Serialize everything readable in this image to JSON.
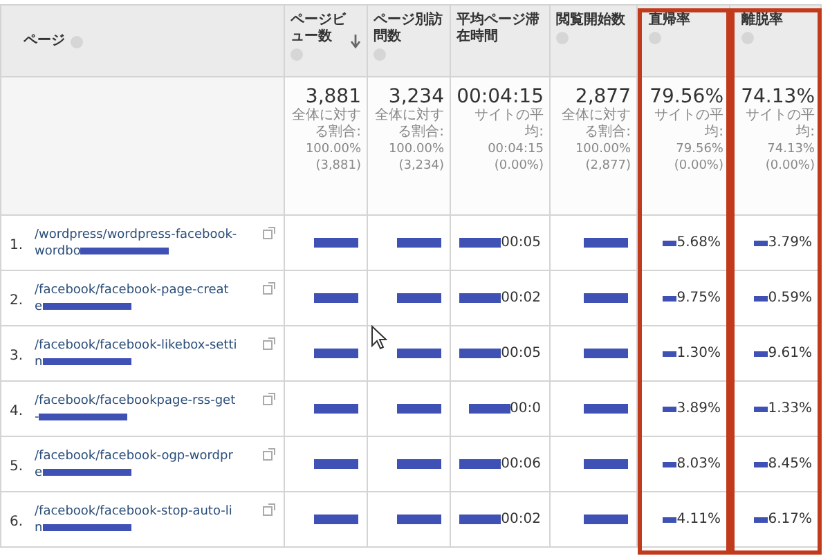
{
  "columns": [
    {
      "label": "ページ",
      "sorted": false,
      "help": true,
      "highlighted": false
    },
    {
      "label": "ページビュー数",
      "sorted": true,
      "help": true,
      "highlighted": false
    },
    {
      "label": "ページ別訪問数",
      "sorted": false,
      "help": true,
      "highlighted": false
    },
    {
      "label": "平均ページ滞在時間",
      "sorted": false,
      "help": false,
      "highlighted": false
    },
    {
      "label": "閲覧開始数",
      "sorted": false,
      "help": true,
      "highlighted": false
    },
    {
      "label": "直帰率",
      "sorted": false,
      "help": true,
      "highlighted": true
    },
    {
      "label": "離脱率",
      "sorted": false,
      "help": true,
      "highlighted": true
    }
  ],
  "summary": [
    {
      "value": "3,881",
      "note": "全体に対する割合:",
      "share": "100.00%",
      "total": "(3,881)"
    },
    {
      "value": "3,234",
      "note": "全体に対する割合:",
      "share": "100.00%",
      "total": "(3,234)"
    },
    {
      "value": "00:04:15",
      "note": "サイトの平均:",
      "share": "00:04:15",
      "total": "(0.00%)"
    },
    {
      "value": "2,877",
      "note": "全体に対する割合:",
      "share": "100.00%",
      "total": "(2,877)"
    },
    {
      "value": "79.56%",
      "note": "サイトの平均:",
      "share": "79.56%",
      "total": "(0.00%)"
    },
    {
      "value": "74.13%",
      "note": "サイトの平均:",
      "share": "74.13%",
      "total": "(0.00%)"
    }
  ],
  "rows": [
    {
      "rank": "1.",
      "page": [
        "/wordpress/wordpress-facebook-",
        "wordbo"
      ],
      "cells": [
        {
          "redacted": true
        },
        {
          "redacted": true
        },
        {
          "text": "00:05",
          "redacted": true
        },
        {
          "redacted": true
        },
        {
          "text": "5.68%",
          "redacted": true
        },
        {
          "text": "3.79%",
          "redacted": true
        }
      ]
    },
    {
      "rank": "2.",
      "page": [
        "/facebook/facebook-page-creat",
        "e"
      ],
      "cells": [
        {
          "redacted": true
        },
        {
          "redacted": true
        },
        {
          "text": "00:02",
          "redacted": true
        },
        {
          "redacted": true
        },
        {
          "text": "9.75%",
          "redacted": true
        },
        {
          "text": "0.59%",
          "redacted": true
        }
      ]
    },
    {
      "rank": "3.",
      "page": [
        "/facebook/facebook-likebox-setti",
        "n"
      ],
      "cells": [
        {
          "redacted": true
        },
        {
          "redacted": true
        },
        {
          "text": "00:05",
          "redacted": true
        },
        {
          "redacted": true
        },
        {
          "text": "1.30%",
          "redacted": true
        },
        {
          "text": "9.61%",
          "redacted": true
        }
      ]
    },
    {
      "rank": "4.",
      "page": [
        "/facebook/facebookpage-rss-get",
        "-"
      ],
      "cells": [
        {
          "redacted": true
        },
        {
          "redacted": true
        },
        {
          "text": "00:0",
          "redacted": true
        },
        {
          "redacted": true
        },
        {
          "text": "3.89%",
          "redacted": true
        },
        {
          "text": "1.33%",
          "redacted": true
        }
      ]
    },
    {
      "rank": "5.",
      "page": [
        "/facebook/facebook-ogp-wordpr",
        "e"
      ],
      "cells": [
        {
          "redacted": true
        },
        {
          "redacted": true
        },
        {
          "text": "00:06",
          "redacted": true
        },
        {
          "redacted": true
        },
        {
          "text": "8.03%",
          "redacted": true
        },
        {
          "text": "8.45%",
          "redacted": true
        }
      ]
    },
    {
      "rank": "6.",
      "page": [
        "/facebook/facebook-stop-auto-li",
        "n"
      ],
      "cells": [
        {
          "redacted": true
        },
        {
          "redacted": true
        },
        {
          "text": "00:02",
          "redacted": true
        },
        {
          "redacted": true
        },
        {
          "text": "4.11%",
          "redacted": true
        },
        {
          "text": "6.17%",
          "redacted": true
        }
      ]
    }
  ]
}
